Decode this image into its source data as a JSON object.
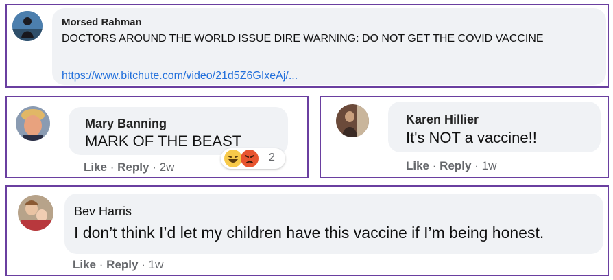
{
  "comments": [
    {
      "author": "Morsed Rahman",
      "text": "DOCTORS AROUND THE WORLD ISSUE DIRE WARNING: DO NOT GET THE COVID VACCINE",
      "link": "https://www.bitchute.com/video/21d5Z6GIxeAj/..."
    },
    {
      "author": "Mary Banning",
      "text": "MARK OF THE BEAST",
      "like_label": "Like",
      "reply_label": "Reply",
      "time": "2w",
      "reaction_count": "2",
      "reactions": [
        "haha-emoji-icon",
        "angry-emoji-icon"
      ]
    },
    {
      "author": "Karen Hillier",
      "text": "It's NOT a vaccine!!",
      "like_label": "Like",
      "reply_label": "Reply",
      "time": "1w"
    },
    {
      "author": "Bev Harris",
      "text": "I don’t think I’d let my children have this vaccine if I’m being honest.",
      "like_label": "Like",
      "reply_label": "Reply",
      "time": "1w"
    }
  ],
  "separator": "·",
  "colors": {
    "border": "#6a3fa0",
    "bubble": "#f0f2f5",
    "link": "#216fdb",
    "meta": "#65676b"
  }
}
